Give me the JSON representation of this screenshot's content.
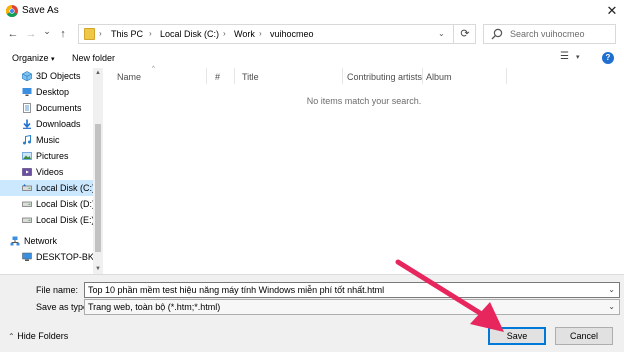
{
  "window": {
    "title": "Save As",
    "close_glyph": "✕"
  },
  "nav_buttons": {
    "back_glyph": "←",
    "forward_glyph": "→",
    "recent_glyph": "⌄",
    "up_glyph": "↑"
  },
  "address": {
    "crumbs": [
      "This PC",
      "Local Disk (C:)",
      "Work",
      "vuihocmeo"
    ],
    "separator": "›",
    "dropdown_glyph": "⌄",
    "refresh_glyph": "⟳"
  },
  "search": {
    "placeholder": "Search vuihocmeo"
  },
  "toolbar": {
    "organize_label": "Organize",
    "organize_chevron": "▾",
    "new_folder_label": "New folder",
    "view_glyph": "☰",
    "view_chevron": "▾",
    "help_glyph": "?"
  },
  "nav_pane": {
    "items": [
      {
        "label": "3D Objects",
        "icon": "cube-icon"
      },
      {
        "label": "Desktop",
        "icon": "desktop-icon"
      },
      {
        "label": "Documents",
        "icon": "documents-icon"
      },
      {
        "label": "Downloads",
        "icon": "download-icon"
      },
      {
        "label": "Music",
        "icon": "music-icon"
      },
      {
        "label": "Pictures",
        "icon": "pictures-icon"
      },
      {
        "label": "Videos",
        "icon": "videos-icon"
      },
      {
        "label": "Local Disk (C:)",
        "icon": "drive-icon",
        "selected": true
      },
      {
        "label": "Local Disk (D:)",
        "icon": "drive-icon"
      },
      {
        "label": "Local Disk (E:)",
        "icon": "drive-icon"
      },
      {
        "label": "Network",
        "icon": "network-icon"
      },
      {
        "label": "DESKTOP-BKMBI",
        "icon": "computer-icon"
      }
    ],
    "scroll_up_glyph": "▲",
    "scroll_down_glyph": "▼"
  },
  "columns": {
    "name": "Name",
    "number": "#",
    "title": "Title",
    "contributing_artists": "Contributing artists",
    "album": "Album",
    "sort_glyph": "^"
  },
  "content": {
    "empty_message": "No items match your search."
  },
  "bottom": {
    "file_name_label": "File name:",
    "file_name_value": "Top 10 phần mềm test hiệu năng máy tính Windows miễn phí tốt nhất.html",
    "save_as_type_label": "Save as type:",
    "save_as_type_value": "Trang web, toàn bộ (*.htm;*.html)",
    "dropdown_glyph": "⌄",
    "hide_folders_glyph": "⌃",
    "hide_folders_label": "Hide Folders",
    "save_label": "Save",
    "cancel_label": "Cancel"
  },
  "colors": {
    "accent": "#0078d7",
    "selected_bg": "#cce8ff",
    "annotation_arrow": "#e8265e"
  }
}
